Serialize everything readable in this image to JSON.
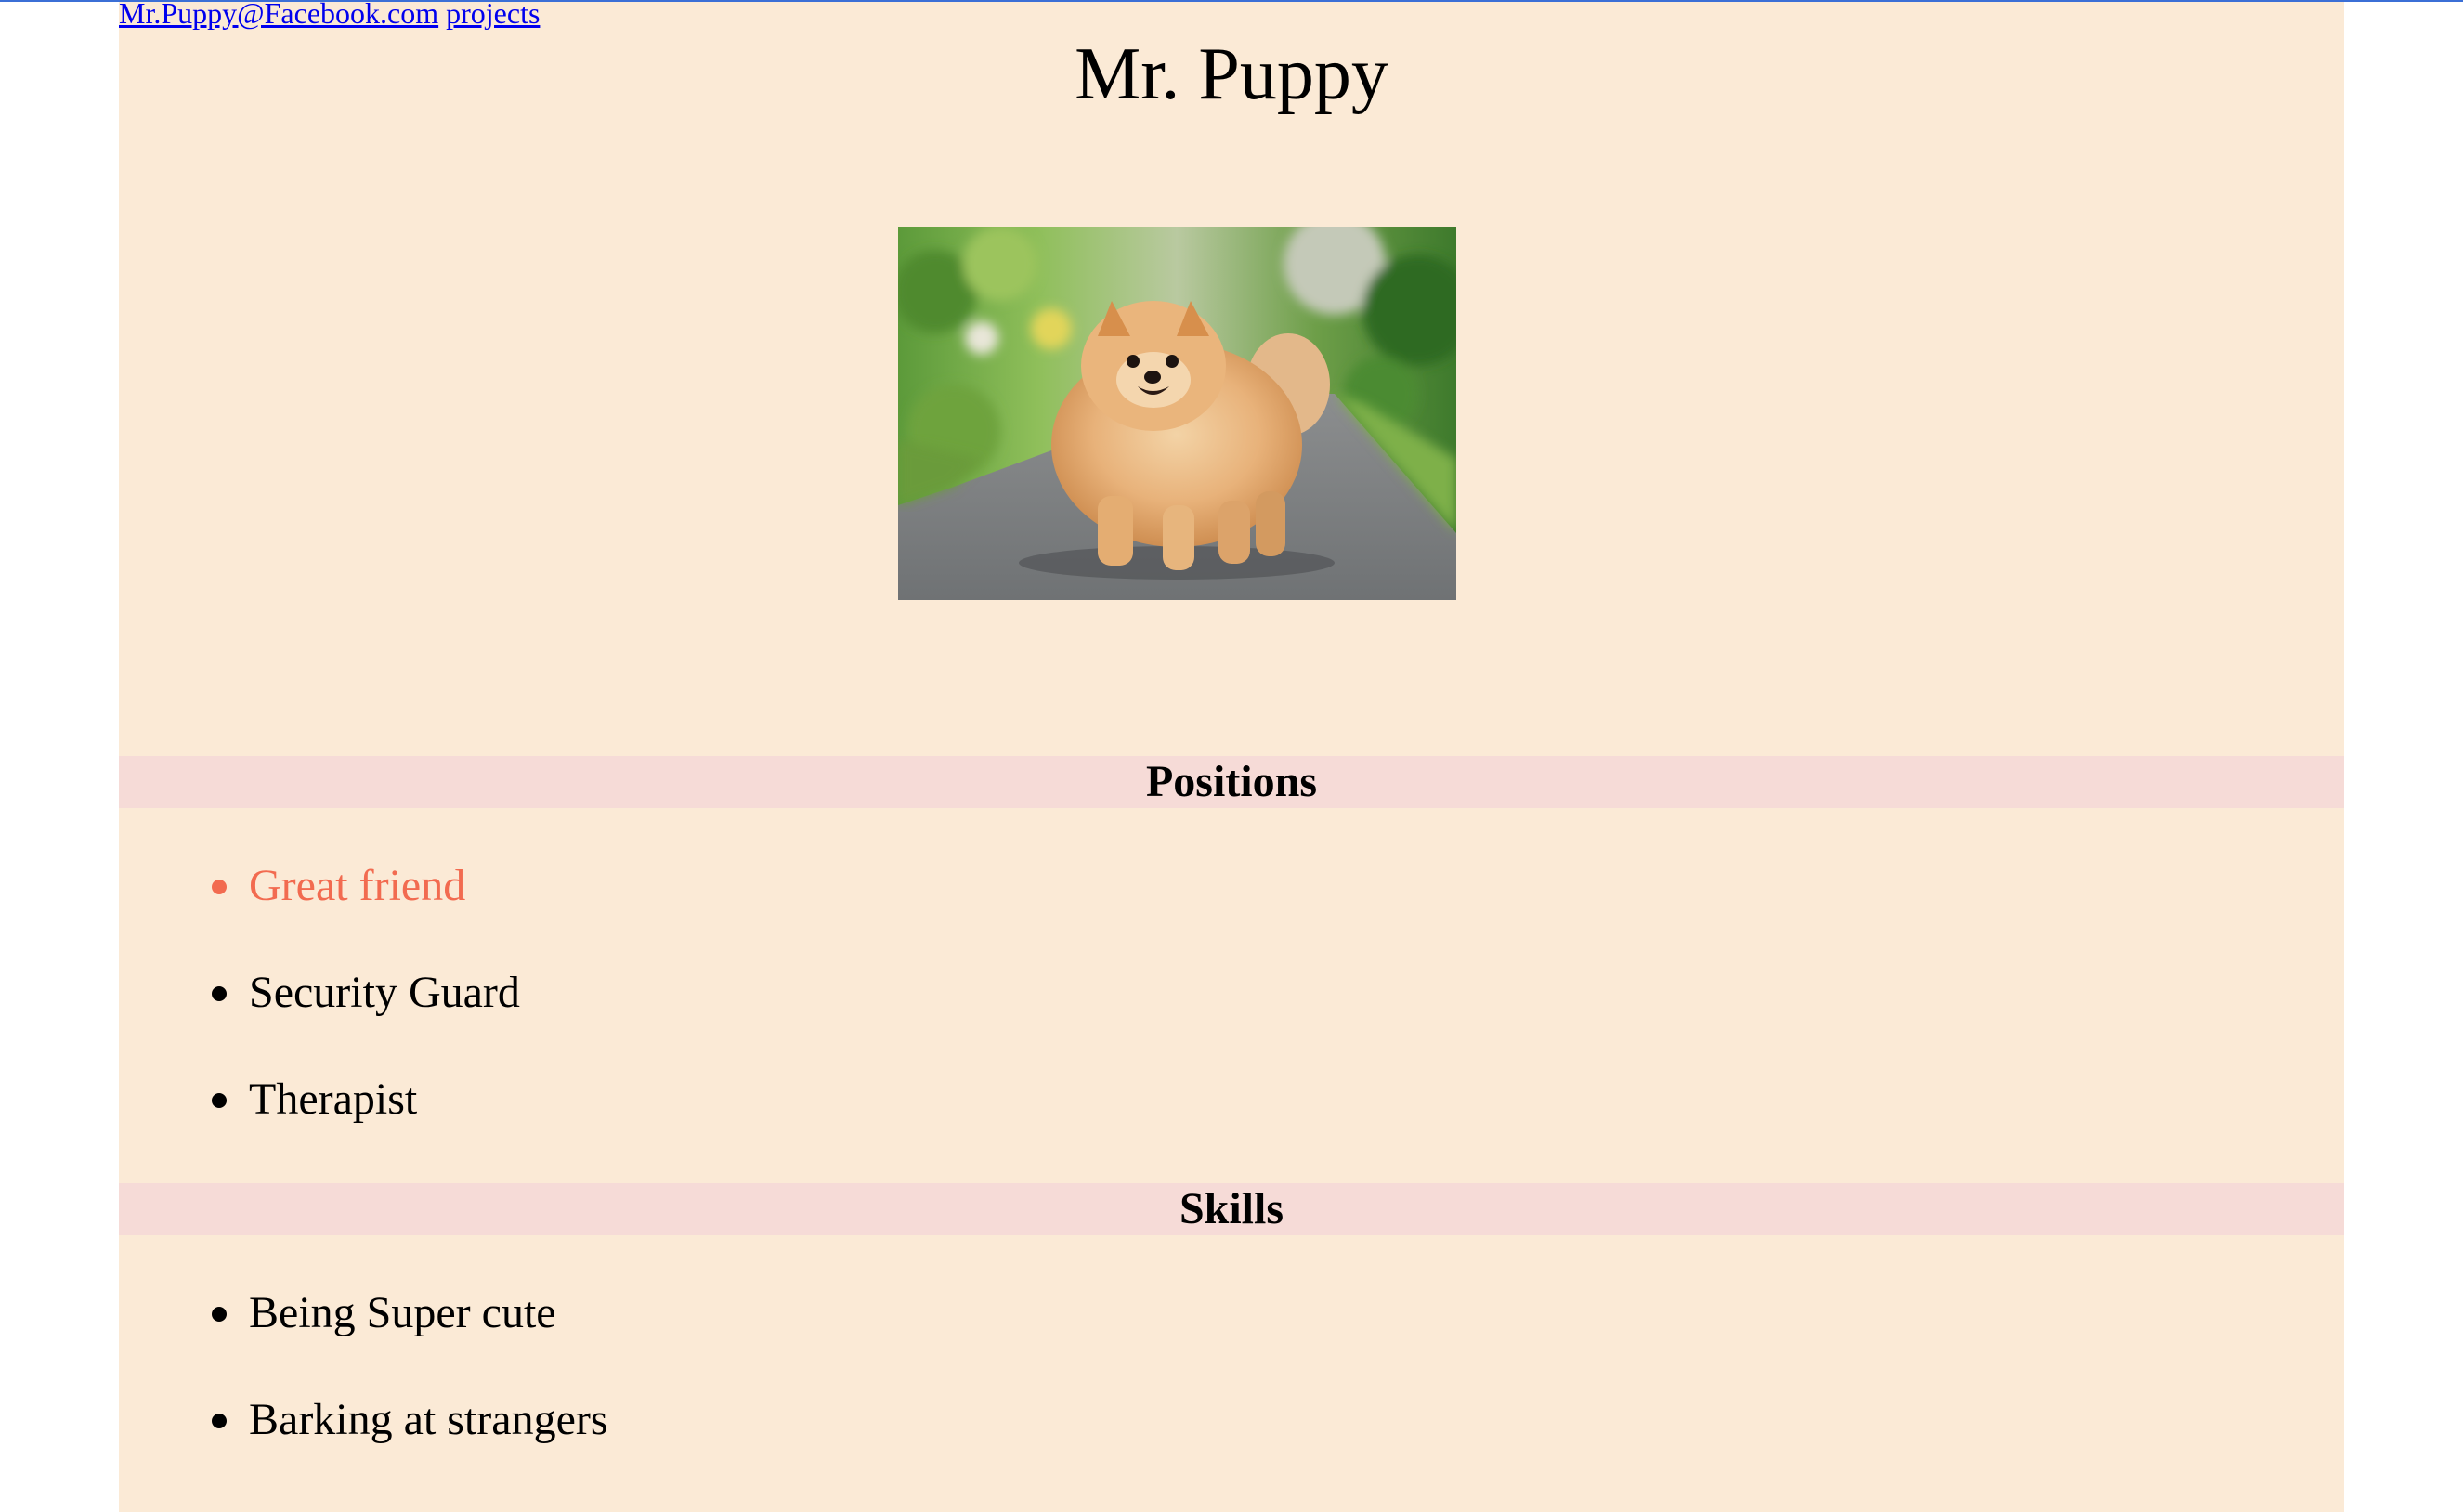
{
  "nav": {
    "email_link": "Mr.Puppy@Facebook.com",
    "projects_link": "projects"
  },
  "page": {
    "title": "Mr. Puppy"
  },
  "photo": {
    "alt": "Pomeranian dog standing on a path"
  },
  "positions": {
    "heading": "Positions",
    "items": [
      "Great friend",
      "Security Guard",
      "Therapist"
    ]
  },
  "skills": {
    "heading": "Skills",
    "items": [
      "Being Super cute",
      "Barking at strangers"
    ]
  },
  "colors": {
    "page_background": "#fbead6",
    "section_header_background": "#f6dbd7",
    "highlight_text": "#f26b50",
    "link": "#0000ee"
  }
}
